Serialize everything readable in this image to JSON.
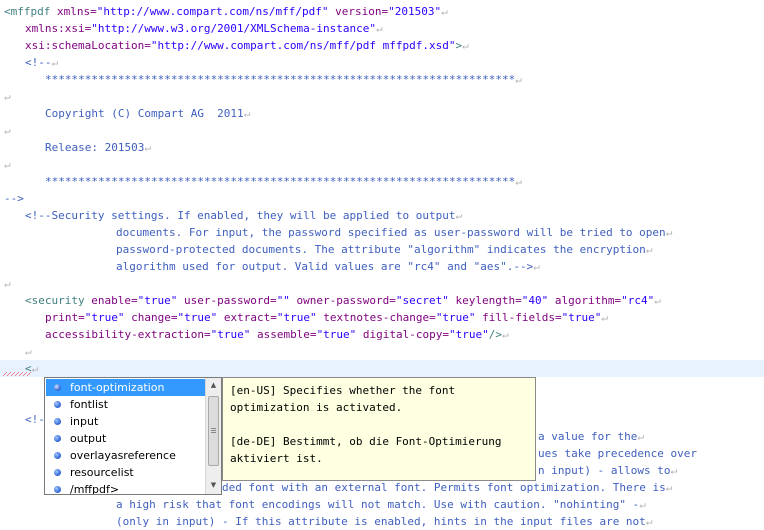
{
  "editor": {
    "line1": {
      "tag": "<mffpdf ",
      "a1": "xmlns=",
      "v1": "\"http://www.compart.com/ns/mff/pdf\"",
      "a2": " version=",
      "v2": "\"201503\""
    },
    "line2": {
      "a1": "xmlns:xsi=",
      "v1": "\"http://www.w3.org/2001/XMLSchema-instance\""
    },
    "line3": {
      "a1": "xsi:schemaLocation=",
      "v1": "\"http://www.compart.com/ns/mff/pdf mffpdf.xsd\"",
      "tag": ">"
    },
    "line4": "<!--",
    "line5": "***********************************************************************",
    "line7": "Copyright (C) Compart AG  2011",
    "line9": "Release: 201503",
    "line11": "***********************************************************************",
    "line12": "-->",
    "line13": "<!--Security settings. If enabled, they will be applied to output",
    "line14": "documents. For input, the password specified as user-password will be tried to open",
    "line15": "password-protected documents. The attribute \"algorithm\" indicates the encryption",
    "line16": "algorithm used for output. Valid values are \"rc4\" and \"aes\".-->",
    "line18": {
      "tag": "<security ",
      "a1": "enable=",
      "v1": "\"true\"",
      "a2": " user-password=",
      "v2": "\"\"",
      "a3": " owner-password=",
      "v3": "\"secret\"",
      "a4": " keylength=",
      "v4": "\"40\"",
      "a5": " algorithm=",
      "v5": "\"rc4\""
    },
    "line19": {
      "a1": "print=",
      "v1": "\"true\"",
      "a2": " change=",
      "v2": "\"true\"",
      "a3": " extract=",
      "v3": "\"true\"",
      "a4": " textnotes-change=",
      "v4": "\"true\"",
      "a5": " fill-fields=",
      "v5": "\"true\""
    },
    "line20": {
      "a1": "accessibility-extraction=",
      "v1": "\"true\"",
      "a2": " assemble=",
      "v2": "\"true\"",
      "a3": " digital-copy=",
      "v3": "\"true\"",
      "tag": "/>"
    },
    "line22": "<",
    "line24": "<!--",
    "line25": "a value for the",
    "line26": "ues take precedence over",
    "line27": "n input) - allows to",
    "line28": "ded font with an external font. Permits font optimization. There is",
    "line29": "a high risk that font encodings will not match. Use with caution. \"nohinting\" -",
    "line30": "(only in input) - If this attribute is enabled, hints in the input files are not",
    "newline_mark": "↵"
  },
  "autocomplete": {
    "items": [
      "font-optimization",
      "fontlist",
      "input",
      "output",
      "overlayasreference",
      "resourcelist",
      "/mffpdf>"
    ],
    "selected": "font-optimization"
  },
  "tooltip": {
    "en1": "[en-US] Specifies whether the font",
    "en2": "optimization is activated.",
    "de1": "[de-DE] Bestimmt, ob die Font-Optimierung",
    "de2": "aktiviert ist."
  }
}
